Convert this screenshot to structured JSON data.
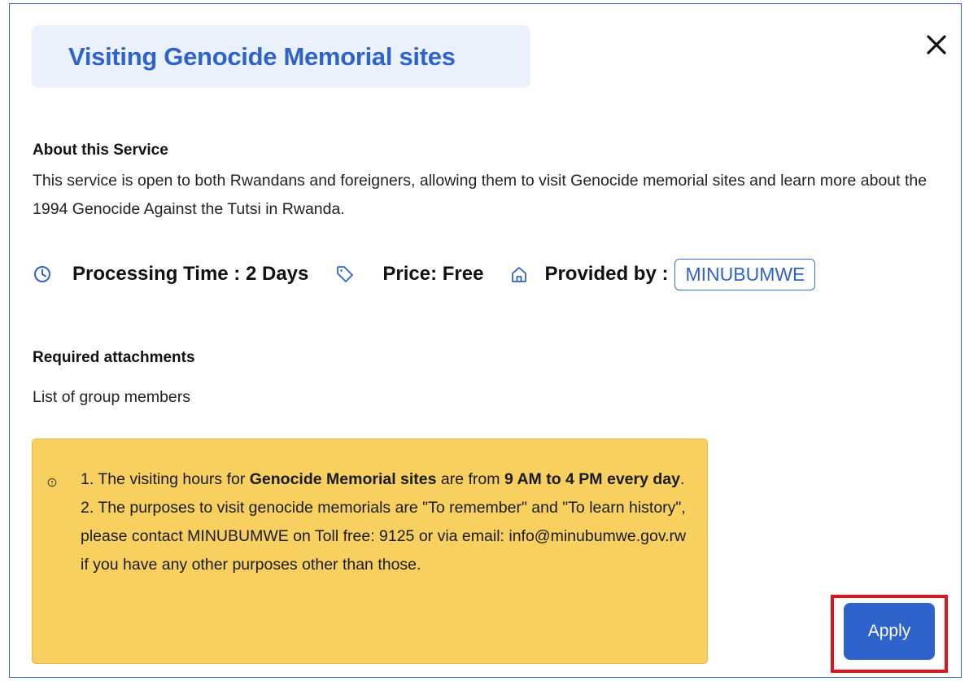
{
  "modal": {
    "title": "Visiting Genocide Memorial sites",
    "close_icon": "close-icon"
  },
  "about": {
    "heading": "About this Service",
    "text": "This service is open to both Rwandans and foreigners, allowing them to visit Genocide memorial sites and learn more about the 1994 Genocide Against the Tutsi in Rwanda."
  },
  "meta": {
    "processing_time": "Processing Time : 2 Days",
    "price": "Price: Free",
    "provided_by_label": "Provided by :",
    "provider": "MINUBUMWE",
    "icons": [
      "clock-icon",
      "tag-icon",
      "home-icon"
    ]
  },
  "attachments": {
    "heading": "Required attachments",
    "items": [
      "List of group members"
    ]
  },
  "notice": {
    "line1_prefix": "1. The visiting hours for ",
    "line1_bold1": "Genocide Memorial sites",
    "line1_mid": " are from ",
    "line1_bold2": "9 AM to 4 PM every day",
    "line1_suffix": ".",
    "line2": "2. The purposes to visit genocide memorials are \"To remember\" and \"To learn history\", please contact MINUBUMWE on Toll free: 9125 or via email: info@minubumwe.gov.rw if you have any other purposes other than those."
  },
  "actions": {
    "apply_label": "Apply"
  },
  "colors": {
    "accent": "#2f63cc",
    "notice_bg": "#f7d060",
    "title_bg": "#eaf1fb",
    "highlight": "#e0141e"
  }
}
